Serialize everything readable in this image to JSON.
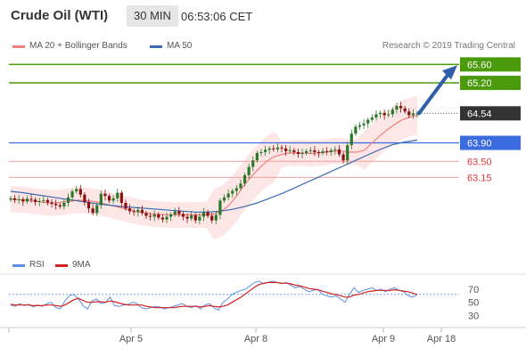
{
  "header": {
    "instrument": "Crude Oil (WTI)",
    "interval": "30 MIN",
    "time": "06:53:06 CET"
  },
  "legend": {
    "ma20_label": "MA 20 + Bollinger Bands",
    "ma50_label": "MA 50",
    "research": "Research © 2019 Trading Central"
  },
  "rsi_legend": {
    "rsi_label": "RSI",
    "ma9_label": "9MA"
  },
  "colors": {
    "ma20": "#f08080",
    "ma50": "#3a6ab0",
    "bollinger_fill": "#fde3e3",
    "resistance": "#4a9a0c",
    "pivot": "#3a6be0",
    "support": "#e0353a",
    "last_price_bg": "#333333",
    "rsi": "#5a8ee0",
    "ma9": "#d42020",
    "candle_up": "#2a7a2a",
    "candle_down": "#8a1010",
    "arrow": "#2f5fa8"
  },
  "chart_data": [
    {
      "type": "candlestick",
      "title": "Crude Oil (WTI)",
      "interval": "30 MIN",
      "x_ticks": [
        "Apr 5",
        "Apr 8",
        "Apr 9",
        "Apr 18"
      ],
      "y_levels": {
        "resistance": [
          65.6,
          65.2
        ],
        "last_price": 64.54,
        "pivot": 63.9,
        "support": [
          63.5,
          63.15
        ]
      },
      "y_range": [
        61.5,
        65.8
      ],
      "close_series": [
        62.7,
        62.66,
        62.68,
        62.63,
        62.69,
        62.67,
        62.62,
        62.64,
        62.66,
        62.61,
        62.58,
        62.55,
        62.52,
        62.6,
        62.72,
        62.85,
        62.9,
        62.78,
        62.62,
        62.48,
        62.38,
        62.55,
        62.8,
        62.75,
        62.65,
        62.7,
        62.82,
        62.6,
        62.48,
        62.42,
        62.4,
        62.45,
        62.38,
        62.32,
        62.3,
        62.35,
        62.28,
        62.24,
        62.3,
        62.35,
        62.42,
        62.36,
        62.3,
        62.26,
        62.33,
        62.22,
        62.3,
        62.4,
        62.32,
        62.22,
        62.34,
        62.65,
        62.72,
        62.8,
        62.86,
        62.92,
        63.02,
        63.2,
        63.38,
        63.52,
        63.68,
        63.7,
        63.75,
        63.78,
        63.76,
        63.8,
        63.78,
        63.72,
        63.74,
        63.7,
        63.66,
        63.68,
        63.72,
        63.74,
        63.7,
        63.68,
        63.72,
        63.7,
        63.74,
        63.76,
        63.65,
        63.52,
        63.85,
        64.1,
        64.25,
        64.28,
        64.32,
        64.4,
        64.45,
        64.52,
        64.55,
        64.5,
        64.52,
        64.62,
        64.7,
        64.65,
        64.58,
        64.5,
        64.54,
        64.54
      ],
      "ma20_series": [
        62.68,
        62.67,
        62.66,
        62.64,
        62.62,
        62.6,
        62.6,
        62.62,
        62.64,
        62.66,
        62.65,
        62.63,
        62.6,
        62.56,
        62.52,
        62.48,
        62.44,
        62.4,
        62.38,
        62.36,
        62.35,
        62.34,
        62.34,
        62.34,
        62.34,
        62.34,
        62.34,
        62.36,
        62.42,
        62.55,
        62.75,
        62.98,
        63.18,
        63.35,
        63.5,
        63.6,
        63.65,
        63.68,
        63.68,
        63.68,
        63.67,
        63.68,
        63.7,
        63.72,
        63.72,
        63.7,
        63.7,
        63.74,
        63.9,
        64.05,
        64.18,
        64.3,
        64.4,
        64.46,
        64.5
      ],
      "ma50_series": [
        62.85,
        62.82,
        62.78,
        62.74,
        62.7,
        62.66,
        62.62,
        62.58,
        62.55,
        62.52,
        62.5,
        62.48,
        62.46,
        62.44,
        62.42,
        62.4,
        62.4,
        62.42,
        62.46,
        62.52,
        62.6,
        62.7,
        62.8,
        62.92,
        63.04,
        63.16,
        63.28,
        63.4,
        63.52,
        63.64,
        63.76,
        63.86,
        63.92,
        63.96
      ],
      "series": [
        {
          "name": "MA 20 + Bollinger Bands"
        },
        {
          "name": "MA 50"
        }
      ]
    },
    {
      "type": "line",
      "y_ticks": [
        70,
        50,
        30
      ],
      "y_range": [
        20,
        90
      ],
      "reference_line": 62,
      "series": [
        {
          "name": "RSI",
          "values": [
            46,
            44,
            48,
            45,
            47,
            43,
            46,
            44,
            48,
            50,
            42,
            40,
            52,
            60,
            62,
            55,
            45,
            40,
            52,
            55,
            48,
            50,
            58,
            45,
            44,
            46,
            47,
            50,
            48,
            42,
            40,
            42,
            44,
            43,
            40,
            42,
            44,
            46,
            48,
            44,
            42,
            45,
            40,
            46,
            48,
            42,
            38,
            50,
            55,
            62,
            65,
            68,
            70,
            75,
            80,
            82,
            78,
            80,
            82,
            80,
            78,
            80,
            76,
            72,
            74,
            70,
            66,
            68,
            70,
            62,
            60,
            58,
            60,
            55,
            50,
            62,
            72,
            65,
            68,
            70,
            72,
            68,
            70,
            66,
            70,
            72,
            68,
            66,
            60,
            58,
            62
          ]
        },
        {
          "name": "9MA",
          "values": [
            47,
            46,
            46,
            46,
            46,
            45,
            45,
            45,
            46,
            46,
            45,
            44,
            46,
            50,
            54,
            56,
            53,
            50,
            50,
            51,
            51,
            50,
            52,
            51,
            49,
            47,
            46,
            46,
            46,
            46,
            44,
            43,
            42,
            42,
            42,
            42,
            42,
            43,
            44,
            44,
            44,
            44,
            43,
            44,
            45,
            44,
            43,
            44,
            46,
            50,
            54,
            58,
            63,
            68,
            73,
            77,
            79,
            80,
            80,
            80,
            79,
            79,
            78,
            76,
            75,
            73,
            71,
            70,
            69,
            67,
            65,
            63,
            62,
            60,
            58,
            58,
            61,
            62,
            64,
            66,
            67,
            68,
            68,
            68,
            68,
            69,
            68,
            67,
            66,
            64,
            62
          ]
        }
      ]
    }
  ]
}
